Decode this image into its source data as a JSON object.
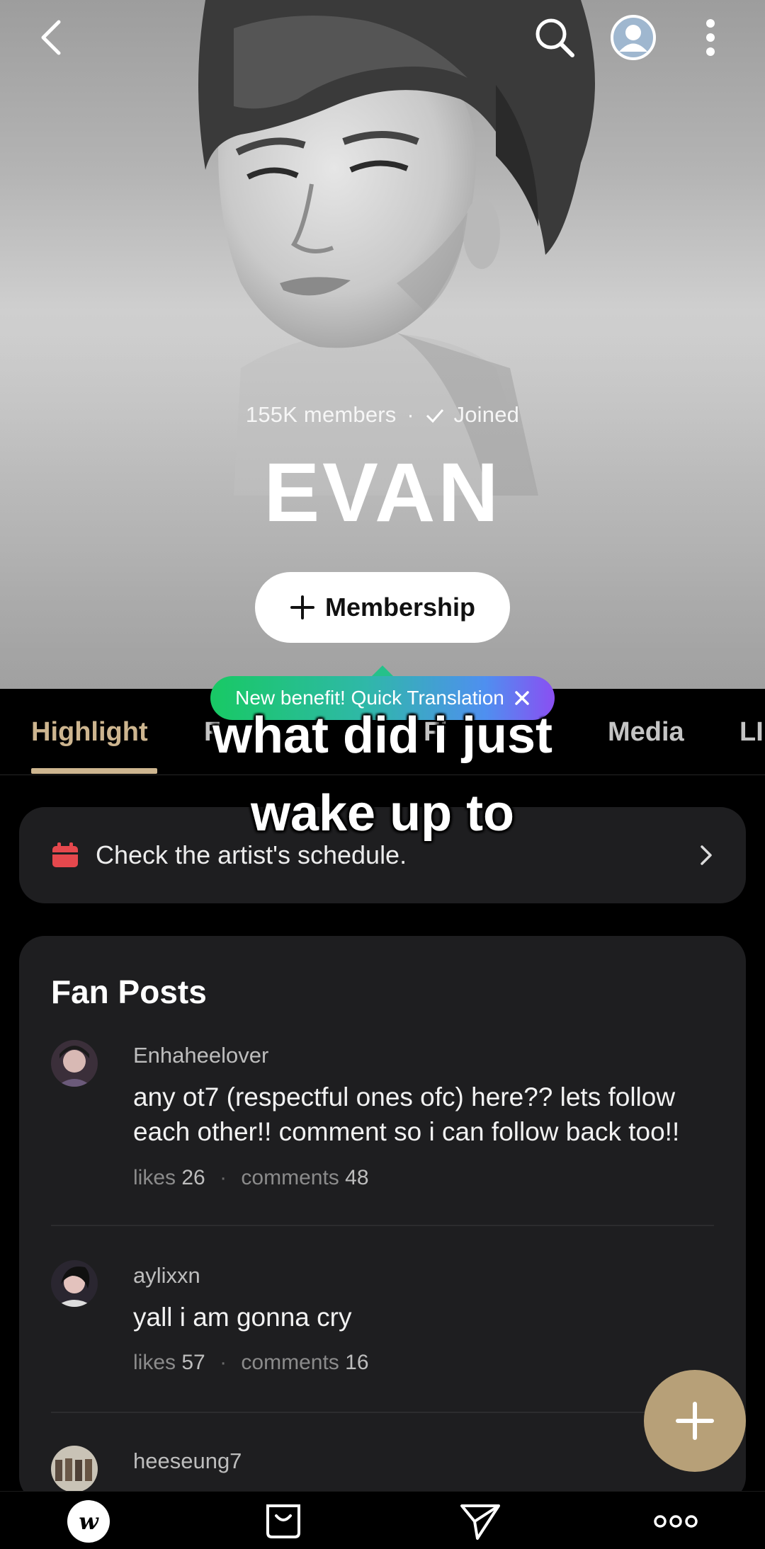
{
  "header": {
    "members": "155K members",
    "separator": "·",
    "joined": "Joined",
    "artist_name": "EVAN",
    "membership_label": "Membership"
  },
  "benefit_banner": {
    "text": "New benefit! Quick Translation"
  },
  "tabs": [
    {
      "label": "Highlight",
      "active": true
    },
    {
      "label": "F",
      "active": false
    },
    {
      "label": "Fi",
      "active": false
    },
    {
      "label": "Media",
      "active": false
    },
    {
      "label": "LI",
      "active": false
    }
  ],
  "caption": {
    "line1": "what did i just",
    "line2": "wake up to"
  },
  "schedule": {
    "text": "Check the artist's schedule."
  },
  "fan_posts": {
    "title": "Fan Posts",
    "likes_label": "likes",
    "comments_label": "comments",
    "posts": [
      {
        "username": "Enhaheelover",
        "body": "any ot7 (respectful ones ofc) here?? lets follow each other!! comment so i can follow back too!!",
        "likes": "26",
        "comments": "48"
      },
      {
        "username": "aylixxn",
        "body": "yall i am gonna cry",
        "likes": "57",
        "comments": "16"
      },
      {
        "username": "heeseung7"
      }
    ]
  },
  "colors": {
    "accent": "#cdb58f",
    "fab": "#b7a078",
    "card_bg": "#1e1e20",
    "schedule_icon": "#e5484d"
  },
  "icons": {
    "top_bar": [
      "back-icon",
      "search-icon",
      "profile-icon",
      "more-vertical-icon"
    ],
    "bottom_nav": [
      "weverse-home-icon",
      "shop-icon",
      "dm-icon",
      "more-icon"
    ]
  }
}
